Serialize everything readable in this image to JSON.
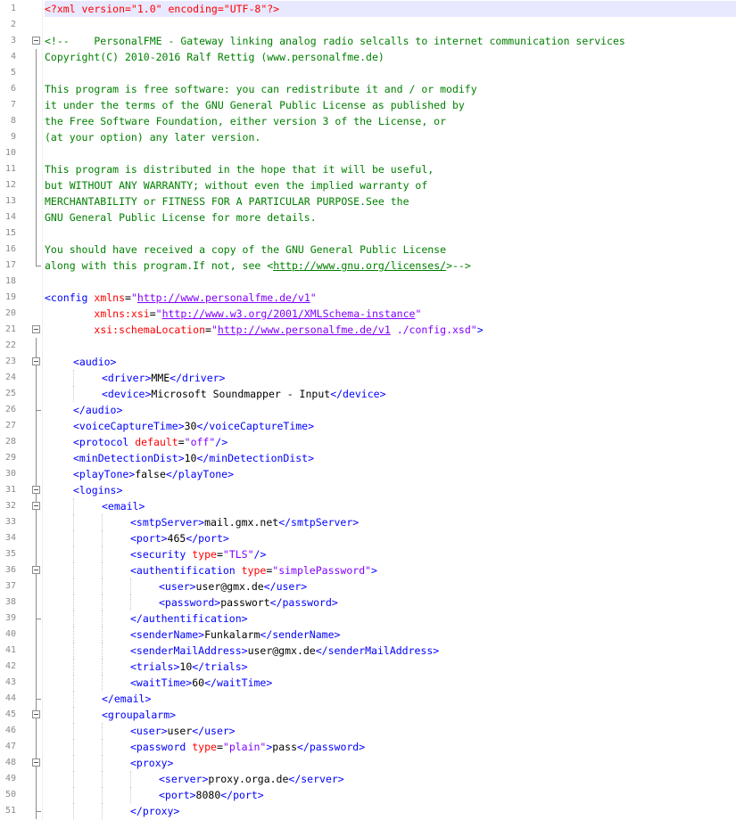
{
  "editor": {
    "theme": {
      "background": "#ffffff",
      "current_line": "#e8e8ff",
      "line_number": "#8a8a8a",
      "tag": "#0000ff",
      "attribute": "#ff0000",
      "value": "#8000ff",
      "comment": "#008000",
      "processing_instruction": "#ff0000",
      "text": "#000000"
    },
    "fold_marker_icon": "fold-minus-icon",
    "lines": [
      {
        "n": "1",
        "indent": 0,
        "tokens": [
          {
            "c": "pi",
            "t": "<?xml version=\"1.0\" encoding=\"UTF-8\"?>"
          }
        ]
      },
      {
        "n": "2",
        "indent": 0,
        "tokens": []
      },
      {
        "n": "3",
        "indent": 0,
        "tokens": [
          {
            "c": "comment",
            "t": "<!--    PersonalFME - Gateway linking analog radio selcalls to internet communication services"
          }
        ]
      },
      {
        "n": "4",
        "indent": 0,
        "tokens": [
          {
            "c": "comment",
            "t": "Copyright(C) 2010-2016 Ralf Rettig (www.personalfme.de)"
          }
        ]
      },
      {
        "n": "5",
        "indent": 0,
        "tokens": []
      },
      {
        "n": "6",
        "indent": 0,
        "tokens": [
          {
            "c": "comment",
            "t": "This program is free software: you can redistribute it and / or modify"
          }
        ]
      },
      {
        "n": "7",
        "indent": 0,
        "tokens": [
          {
            "c": "comment",
            "t": "it under the terms of the GNU General Public License as published by"
          }
        ]
      },
      {
        "n": "8",
        "indent": 0,
        "tokens": [
          {
            "c": "comment",
            "t": "the Free Software Foundation, either version 3 of the License, or"
          }
        ]
      },
      {
        "n": "9",
        "indent": 0,
        "tokens": [
          {
            "c": "comment",
            "t": "(at your option) any later version."
          }
        ]
      },
      {
        "n": "10",
        "indent": 0,
        "tokens": []
      },
      {
        "n": "11",
        "indent": 0,
        "tokens": [
          {
            "c": "comment",
            "t": "This program is distributed in the hope that it will be useful,"
          }
        ]
      },
      {
        "n": "12",
        "indent": 0,
        "tokens": [
          {
            "c": "comment",
            "t": "but WITHOUT ANY WARRANTY; without even the implied warranty of"
          }
        ]
      },
      {
        "n": "13",
        "indent": 0,
        "tokens": [
          {
            "c": "comment",
            "t": "MERCHANTABILITY or FITNESS FOR A PARTICULAR PURPOSE.See the"
          }
        ]
      },
      {
        "n": "14",
        "indent": 0,
        "tokens": [
          {
            "c": "comment",
            "t": "GNU General Public License for more details."
          }
        ]
      },
      {
        "n": "15",
        "indent": 0,
        "tokens": []
      },
      {
        "n": "16",
        "indent": 0,
        "tokens": [
          {
            "c": "comment",
            "t": "You should have received a copy of the GNU General Public License"
          }
        ]
      },
      {
        "n": "17",
        "indent": 0,
        "tokens": [
          {
            "c": "comment",
            "t": "along with this program.If not, see <"
          },
          {
            "c": "cmturl",
            "t": "http://www.gnu.org/licenses/"
          },
          {
            "c": "comment",
            "t": ">-->"
          }
        ]
      },
      {
        "n": "18",
        "indent": 0,
        "tokens": []
      },
      {
        "n": "19",
        "indent": 0,
        "tokens": [
          {
            "c": "tag",
            "t": "<config "
          },
          {
            "c": "attr",
            "t": "xmlns"
          },
          {
            "c": "eq",
            "t": "="
          },
          {
            "c": "val",
            "t": "\""
          },
          {
            "c": "url",
            "t": "http://www.personalfme.de/v1"
          },
          {
            "c": "val",
            "t": "\""
          }
        ]
      },
      {
        "n": "20",
        "indent": 0,
        "tokens": [
          {
            "c": "text",
            "t": "        "
          },
          {
            "c": "attr",
            "t": "xmlns:xsi"
          },
          {
            "c": "eq",
            "t": "="
          },
          {
            "c": "val",
            "t": "\""
          },
          {
            "c": "url",
            "t": "http://www.w3.org/2001/XMLSchema-instance"
          },
          {
            "c": "val",
            "t": "\""
          }
        ]
      },
      {
        "n": "21",
        "indent": 0,
        "tokens": [
          {
            "c": "text",
            "t": "        "
          },
          {
            "c": "attr",
            "t": "xsi:schemaLocation"
          },
          {
            "c": "eq",
            "t": "="
          },
          {
            "c": "val",
            "t": "\""
          },
          {
            "c": "url",
            "t": "http://www.personalfme.de/v1"
          },
          {
            "c": "val",
            "t": " ./config.xsd\""
          },
          {
            "c": "tag",
            "t": ">"
          }
        ]
      },
      {
        "n": "22",
        "indent": 0,
        "tokens": []
      },
      {
        "n": "23",
        "indent": 1,
        "tokens": [
          {
            "c": "tag",
            "t": "<audio>"
          }
        ]
      },
      {
        "n": "24",
        "indent": 2,
        "tokens": [
          {
            "c": "tag",
            "t": "<driver>"
          },
          {
            "c": "text",
            "t": "MME"
          },
          {
            "c": "tag",
            "t": "</driver>"
          }
        ]
      },
      {
        "n": "25",
        "indent": 2,
        "tokens": [
          {
            "c": "tag",
            "t": "<device>"
          },
          {
            "c": "text",
            "t": "Microsoft Soundmapper - Input"
          },
          {
            "c": "tag",
            "t": "</device>"
          }
        ]
      },
      {
        "n": "26",
        "indent": 1,
        "tokens": [
          {
            "c": "tag",
            "t": "</audio>"
          }
        ]
      },
      {
        "n": "27",
        "indent": 1,
        "tokens": [
          {
            "c": "tag",
            "t": "<voiceCaptureTime>"
          },
          {
            "c": "text",
            "t": "30"
          },
          {
            "c": "tag",
            "t": "</voiceCaptureTime>"
          }
        ]
      },
      {
        "n": "28",
        "indent": 1,
        "tokens": [
          {
            "c": "tag",
            "t": "<protocol "
          },
          {
            "c": "attr",
            "t": "default"
          },
          {
            "c": "eq",
            "t": "="
          },
          {
            "c": "val",
            "t": "\"off\""
          },
          {
            "c": "tag",
            "t": "/>"
          }
        ]
      },
      {
        "n": "29",
        "indent": 1,
        "tokens": [
          {
            "c": "tag",
            "t": "<minDetectionDist>"
          },
          {
            "c": "text",
            "t": "10"
          },
          {
            "c": "tag",
            "t": "</minDetectionDist>"
          }
        ]
      },
      {
        "n": "30",
        "indent": 1,
        "tokens": [
          {
            "c": "tag",
            "t": "<playTone>"
          },
          {
            "c": "text",
            "t": "false"
          },
          {
            "c": "tag",
            "t": "</playTone>"
          }
        ]
      },
      {
        "n": "31",
        "indent": 1,
        "tokens": [
          {
            "c": "tag",
            "t": "<logins>"
          }
        ]
      },
      {
        "n": "32",
        "indent": 2,
        "tokens": [
          {
            "c": "tag",
            "t": "<email>"
          }
        ]
      },
      {
        "n": "33",
        "indent": 3,
        "tokens": [
          {
            "c": "tag",
            "t": "<smtpServer>"
          },
          {
            "c": "text",
            "t": "mail.gmx.net"
          },
          {
            "c": "tag",
            "t": "</smtpServer>"
          }
        ]
      },
      {
        "n": "34",
        "indent": 3,
        "tokens": [
          {
            "c": "tag",
            "t": "<port>"
          },
          {
            "c": "text",
            "t": "465"
          },
          {
            "c": "tag",
            "t": "</port>"
          }
        ]
      },
      {
        "n": "35",
        "indent": 3,
        "tokens": [
          {
            "c": "tag",
            "t": "<security "
          },
          {
            "c": "attr",
            "t": "type"
          },
          {
            "c": "eq",
            "t": "="
          },
          {
            "c": "val",
            "t": "\"TLS\""
          },
          {
            "c": "tag",
            "t": "/>"
          }
        ]
      },
      {
        "n": "36",
        "indent": 3,
        "tokens": [
          {
            "c": "tag",
            "t": "<authentification "
          },
          {
            "c": "attr",
            "t": "type"
          },
          {
            "c": "eq",
            "t": "="
          },
          {
            "c": "val",
            "t": "\"simplePassword\""
          },
          {
            "c": "tag",
            "t": ">"
          }
        ]
      },
      {
        "n": "37",
        "indent": 4,
        "tokens": [
          {
            "c": "tag",
            "t": "<user>"
          },
          {
            "c": "text",
            "t": "user@gmx.de"
          },
          {
            "c": "tag",
            "t": "</user>"
          }
        ]
      },
      {
        "n": "38",
        "indent": 4,
        "tokens": [
          {
            "c": "tag",
            "t": "<password>"
          },
          {
            "c": "text",
            "t": "passwort"
          },
          {
            "c": "tag",
            "t": "</password>"
          }
        ]
      },
      {
        "n": "39",
        "indent": 3,
        "tokens": [
          {
            "c": "tag",
            "t": "</authentification>"
          }
        ]
      },
      {
        "n": "40",
        "indent": 3,
        "tokens": [
          {
            "c": "tag",
            "t": "<senderName>"
          },
          {
            "c": "text",
            "t": "Funkalarm"
          },
          {
            "c": "tag",
            "t": "</senderName>"
          }
        ]
      },
      {
        "n": "41",
        "indent": 3,
        "tokens": [
          {
            "c": "tag",
            "t": "<senderMailAddress>"
          },
          {
            "c": "text",
            "t": "user@gmx.de"
          },
          {
            "c": "tag",
            "t": "</senderMailAddress>"
          }
        ]
      },
      {
        "n": "42",
        "indent": 3,
        "tokens": [
          {
            "c": "tag",
            "t": "<trials>"
          },
          {
            "c": "text",
            "t": "10"
          },
          {
            "c": "tag",
            "t": "</trials>"
          }
        ]
      },
      {
        "n": "43",
        "indent": 3,
        "tokens": [
          {
            "c": "tag",
            "t": "<waitTime>"
          },
          {
            "c": "text",
            "t": "60"
          },
          {
            "c": "tag",
            "t": "</waitTime>"
          }
        ]
      },
      {
        "n": "44",
        "indent": 2,
        "tokens": [
          {
            "c": "tag",
            "t": "</email>"
          }
        ]
      },
      {
        "n": "45",
        "indent": 2,
        "tokens": [
          {
            "c": "tag",
            "t": "<groupalarm>"
          }
        ]
      },
      {
        "n": "46",
        "indent": 3,
        "tokens": [
          {
            "c": "tag",
            "t": "<user>"
          },
          {
            "c": "text",
            "t": "user"
          },
          {
            "c": "tag",
            "t": "</user>"
          }
        ]
      },
      {
        "n": "47",
        "indent": 3,
        "tokens": [
          {
            "c": "tag",
            "t": "<password "
          },
          {
            "c": "attr",
            "t": "type"
          },
          {
            "c": "eq",
            "t": "="
          },
          {
            "c": "val",
            "t": "\"plain\""
          },
          {
            "c": "tag",
            "t": ">"
          },
          {
            "c": "text",
            "t": "pass"
          },
          {
            "c": "tag",
            "t": "</password>"
          }
        ]
      },
      {
        "n": "48",
        "indent": 3,
        "tokens": [
          {
            "c": "tag",
            "t": "<proxy>"
          }
        ]
      },
      {
        "n": "49",
        "indent": 4,
        "tokens": [
          {
            "c": "tag",
            "t": "<server>"
          },
          {
            "c": "text",
            "t": "proxy.orga.de"
          },
          {
            "c": "tag",
            "t": "</server>"
          }
        ]
      },
      {
        "n": "50",
        "indent": 4,
        "tokens": [
          {
            "c": "tag",
            "t": "<port>"
          },
          {
            "c": "text",
            "t": "8080"
          },
          {
            "c": "tag",
            "t": "</port>"
          }
        ]
      },
      {
        "n": "51",
        "indent": 3,
        "tokens": [
          {
            "c": "tag",
            "t": "</proxy>"
          }
        ]
      }
    ]
  }
}
